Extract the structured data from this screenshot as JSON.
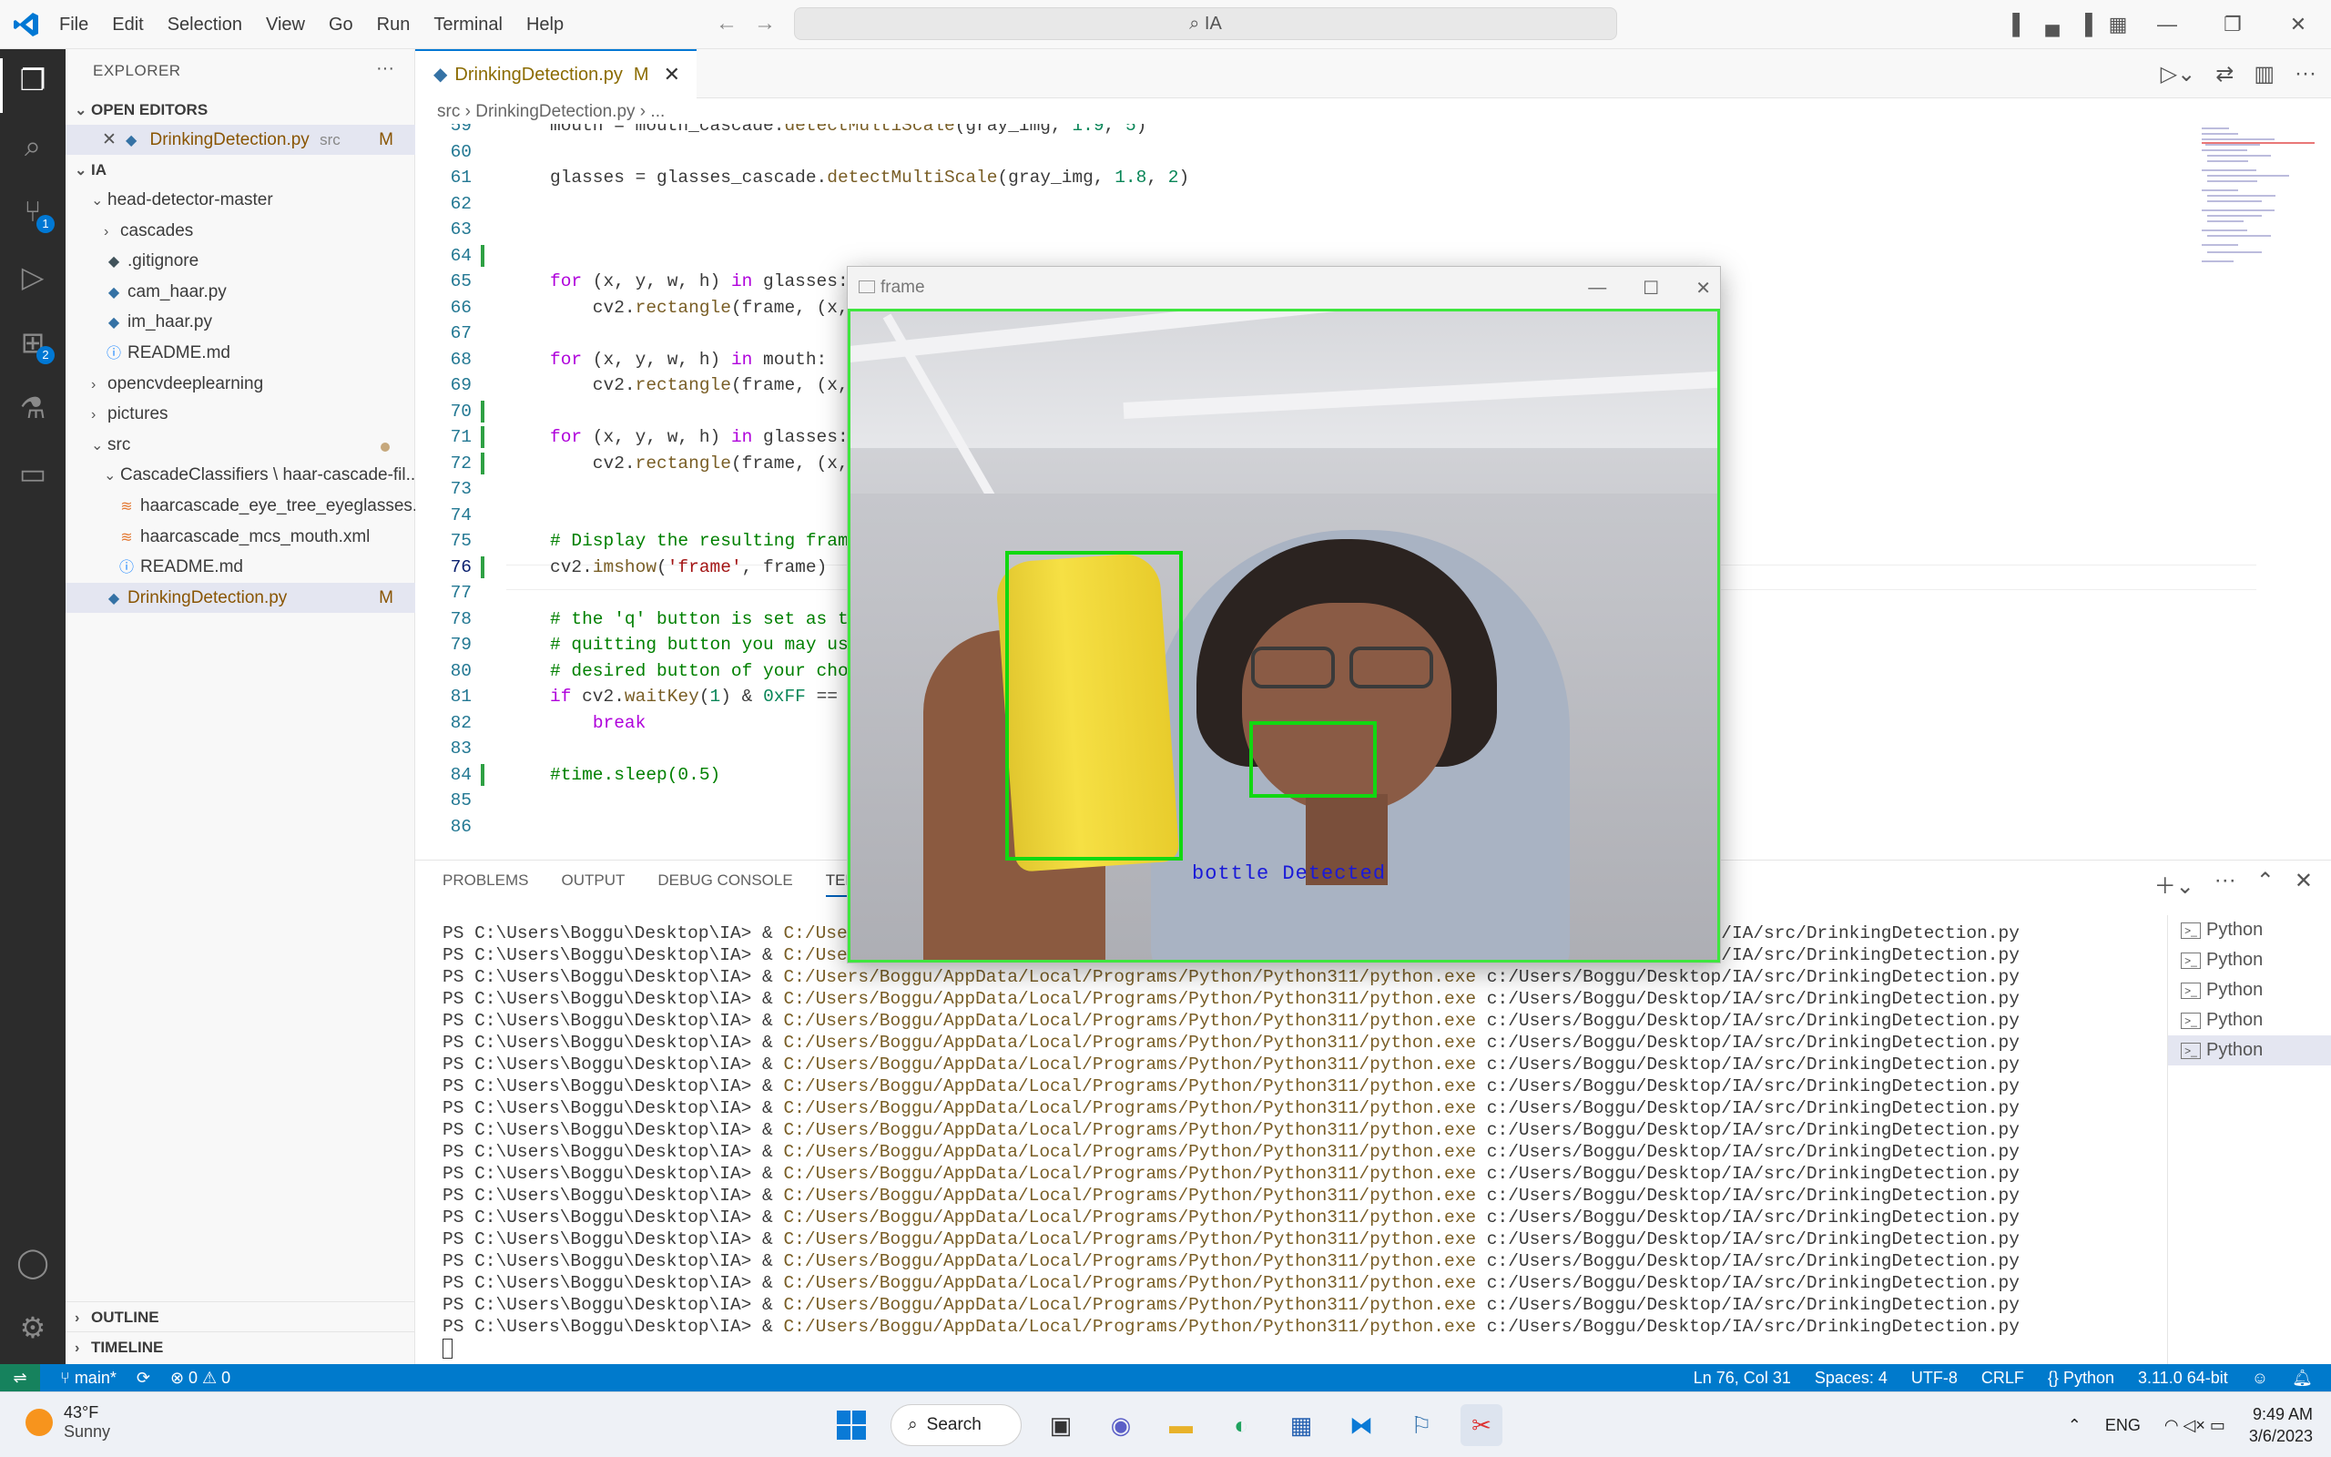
{
  "titlebar": {
    "menu": [
      "File",
      "Edit",
      "Selection",
      "View",
      "Go",
      "Run",
      "Terminal",
      "Help"
    ],
    "search": "IA"
  },
  "explorer": {
    "title": "EXPLORER",
    "open_editors_label": "OPEN EDITORS",
    "open_editor": {
      "name": "DrinkingDetection.py",
      "path": "src",
      "status": "M"
    },
    "root": "IA",
    "tree": [
      {
        "label": "head-detector-master",
        "kind": "folder-open",
        "indent": 1
      },
      {
        "label": "cascades",
        "kind": "folder",
        "indent": 2
      },
      {
        "label": ".gitignore",
        "kind": "git",
        "indent": 2
      },
      {
        "label": "cam_haar.py",
        "kind": "py",
        "indent": 2
      },
      {
        "label": "im_haar.py",
        "kind": "py",
        "indent": 2
      },
      {
        "label": "README.md",
        "kind": "info",
        "indent": 2
      },
      {
        "label": "opencvdeeplearning",
        "kind": "folder",
        "indent": 1
      },
      {
        "label": "pictures",
        "kind": "folder",
        "indent": 1
      },
      {
        "label": "src",
        "kind": "folder-open",
        "indent": 1
      },
      {
        "label": "CascadeClassifiers \\ haar-cascade-fil...",
        "kind": "folder-open",
        "indent": 2
      },
      {
        "label": "haarcascade_eye_tree_eyeglasses....",
        "kind": "xml",
        "indent": 3
      },
      {
        "label": "haarcascade_mcs_mouth.xml",
        "kind": "xml",
        "indent": 3
      },
      {
        "label": "README.md",
        "kind": "info",
        "indent": 3
      },
      {
        "label": "DrinkingDetection.py",
        "kind": "py",
        "indent": 2
      }
    ],
    "outline": "OUTLINE",
    "timeline": "TIMELINE"
  },
  "editor": {
    "tab": {
      "name": "DrinkingDetection.py",
      "status": "M"
    },
    "breadcrumb": [
      "src",
      "DrinkingDetection.py",
      "..."
    ],
    "lines": [
      {
        "n": "59",
        "text": "mouth = mouth_cascade.detectMultiScale(gray_img, 1.9, 5)"
      },
      {
        "n": "60",
        "text": ""
      },
      {
        "n": "61",
        "text": "glasses = glasses_cascade.detectMultiScale(gray_img, 1.8, 2)"
      },
      {
        "n": "62",
        "text": ""
      },
      {
        "n": "63",
        "text": ""
      },
      {
        "n": "64",
        "text": ""
      },
      {
        "n": "65",
        "text": "for (x, y, w, h) in glasses:"
      },
      {
        "n": "66",
        "text": "    cv2.rectangle(frame, (x,"
      },
      {
        "n": "67",
        "text": ""
      },
      {
        "n": "68",
        "text": "for (x, y, w, h) in mouth:"
      },
      {
        "n": "69",
        "text": "    cv2.rectangle(frame, (x,"
      },
      {
        "n": "70",
        "text": ""
      },
      {
        "n": "71",
        "text": "for (x, y, w, h) in glasses:"
      },
      {
        "n": "72",
        "text": "    cv2.rectangle(frame, (x,"
      },
      {
        "n": "73",
        "text": ""
      },
      {
        "n": "74",
        "text": ""
      },
      {
        "n": "75",
        "text": "# Display the resulting fram"
      },
      {
        "n": "76",
        "text": "cv2.imshow('frame', frame)"
      },
      {
        "n": "77",
        "text": ""
      },
      {
        "n": "78",
        "text": "# the 'q' button is set as t"
      },
      {
        "n": "79",
        "text": "# quitting button you may us"
      },
      {
        "n": "80",
        "text": "# desired button of your cho"
      },
      {
        "n": "81",
        "text": "if cv2.waitKey(1) & 0xFF == ("
      },
      {
        "n": "82",
        "text": "    break"
      },
      {
        "n": "83",
        "text": ""
      },
      {
        "n": "84",
        "text": "#time.sleep(0.5)"
      },
      {
        "n": "85",
        "text": ""
      },
      {
        "n": "86",
        "text": ""
      }
    ]
  },
  "panel": {
    "tabs": [
      "PROBLEMS",
      "OUTPUT",
      "DEBUG CONSOLE",
      "TERMINAL"
    ],
    "active_tab": "TERMINAL",
    "prompt": "PS C:\\Users\\Boggu\\Desktop\\IA> & ",
    "exe": "C:/Users/Boggu/AppData/Local/Programs/Python/Python311/python.exe",
    "script": " c:/Users/Boggu/Desktop/IA/src/DrinkingDetection.py",
    "line_count": 19,
    "terminals": [
      "Python",
      "Python",
      "Python",
      "Python",
      "Python"
    ]
  },
  "frame_window": {
    "title": "frame",
    "label": "bottle Detected"
  },
  "statusbar": {
    "branch": "main*",
    "problems": "⊗ 0 ⚠ 0",
    "position": "Ln 76, Col 31",
    "spaces": "Spaces: 4",
    "encoding": "UTF-8",
    "eol": "CRLF",
    "language": "Python",
    "interpreter": "3.11.0 64-bit"
  },
  "taskbar": {
    "temp": "43°F",
    "weather": "Sunny",
    "search": "Search",
    "lang": "ENG",
    "time": "9:49 AM",
    "date": "3/6/2023"
  },
  "colors": {
    "accent": "#007acc",
    "detect_green": "#11d811",
    "label_blue": "#1a1ad8"
  }
}
